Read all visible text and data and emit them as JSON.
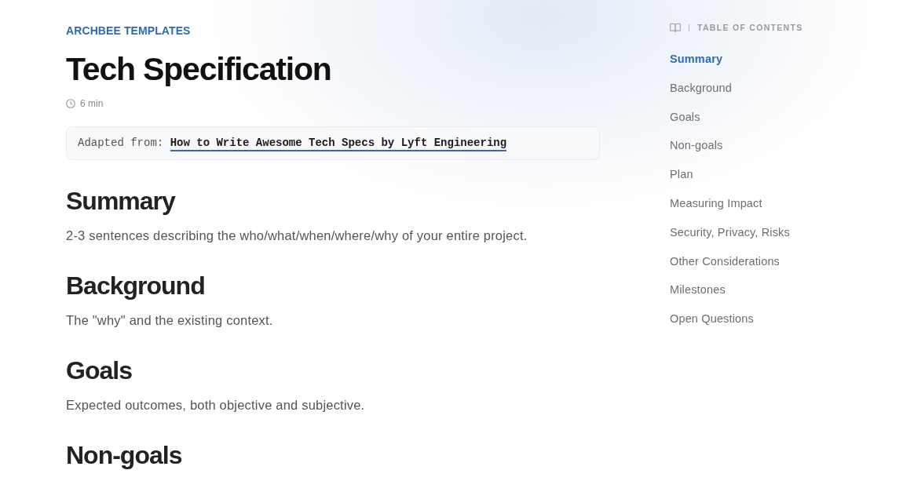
{
  "header": {
    "eyebrow": "ARCHBEE TEMPLATES",
    "title": "Tech Specification",
    "reading_time": "6 min"
  },
  "callout": {
    "label": "Adapted from:",
    "link": "How to Write Awesome Tech Specs by Lyft Engineering"
  },
  "sections": [
    {
      "heading": "Summary",
      "body": "2-3 sentences describing the who/what/when/where/why of your entire project."
    },
    {
      "heading": "Background",
      "body": "The \"why\" and the existing context."
    },
    {
      "heading": "Goals",
      "body": "Expected outcomes, both objective and subjective."
    },
    {
      "heading": "Non-goals"
    }
  ],
  "toc": {
    "title": "TABLE OF CONTENTS",
    "items": [
      {
        "label": "Summary",
        "selected": true
      },
      {
        "label": "Background",
        "selected": false
      },
      {
        "label": "Goals",
        "selected": false
      },
      {
        "label": "Non-goals",
        "selected": false
      },
      {
        "label": "Plan",
        "selected": false
      },
      {
        "label": "Measuring Impact",
        "selected": false
      },
      {
        "label": "Security, Privacy, Risks",
        "selected": false
      },
      {
        "label": "Other Considerations",
        "selected": false
      },
      {
        "label": "Milestones",
        "selected": false
      },
      {
        "label": "Open Questions",
        "selected": false
      }
    ]
  }
}
